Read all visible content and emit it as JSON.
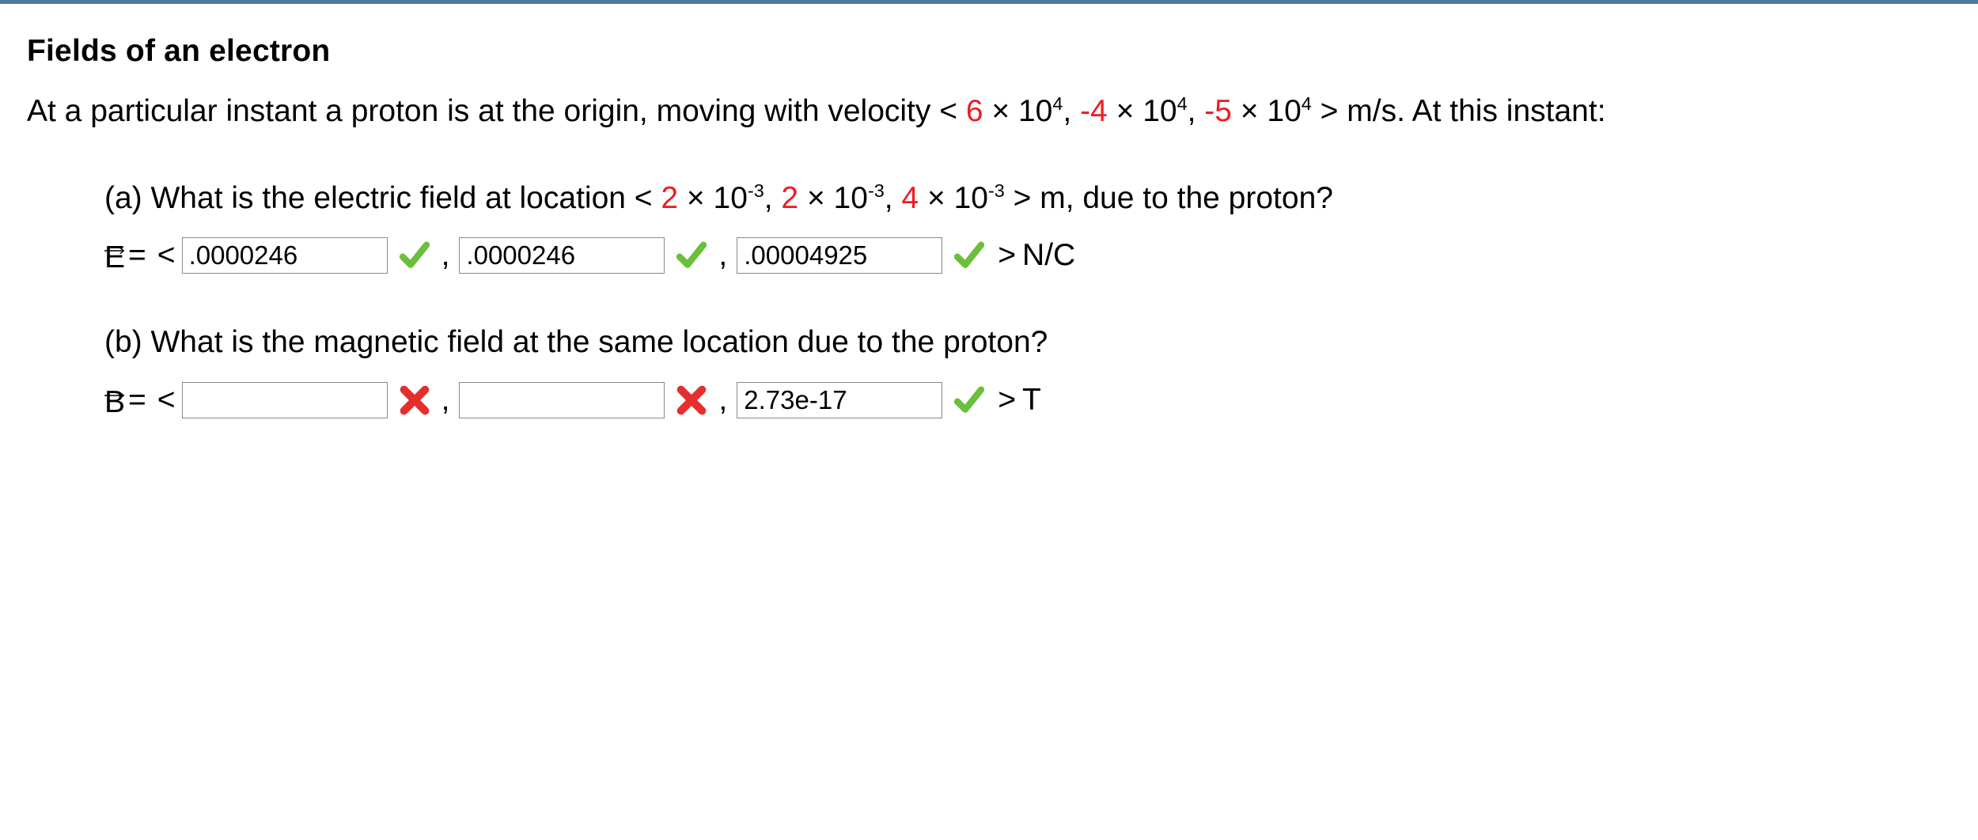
{
  "title": "Fields of an electron",
  "intro": {
    "p1": "At a particular instant a proton is at the origin, moving with velocity < ",
    "v1_coef": "6",
    "times1": " × 10",
    "exp1": "4",
    "sep1": ", ",
    "v2_coef": "-4",
    "times2": " × 10",
    "exp2": "4",
    "sep2": ", ",
    "v3_coef": "-5",
    "times3": " × 10",
    "exp3": "4",
    "p_end": " > m/s. At this instant:"
  },
  "a": {
    "q1": "(a) What is the electric field at location < ",
    "c1": "2",
    "x1": " × 10",
    "e1": "-3",
    "s1": ", ",
    "c2": "2",
    "x2": " × 10",
    "e2": "-3",
    "s2": ", ",
    "c3": "4",
    "x3": " × 10",
    "e3": "-3",
    "q_end": " > m, due to the proton?",
    "vec_label": "E",
    "eq": " = ",
    "lt": "<",
    "gt": ">",
    "v1": ".0000246",
    "v2": ".0000246",
    "v3": ".00004925",
    "unit": "N/C",
    "comma": ",",
    "status": [
      "correct",
      "correct",
      "correct"
    ]
  },
  "b": {
    "q": "(b) What is the magnetic field at the same location due to the proton?",
    "vec_label": "B",
    "eq": " = ",
    "lt": "<",
    "gt": ">",
    "v1": "",
    "v2": "",
    "v3": "2.73e-17",
    "unit": "T",
    "comma": ",",
    "status": [
      "incorrect",
      "incorrect",
      "correct"
    ]
  }
}
